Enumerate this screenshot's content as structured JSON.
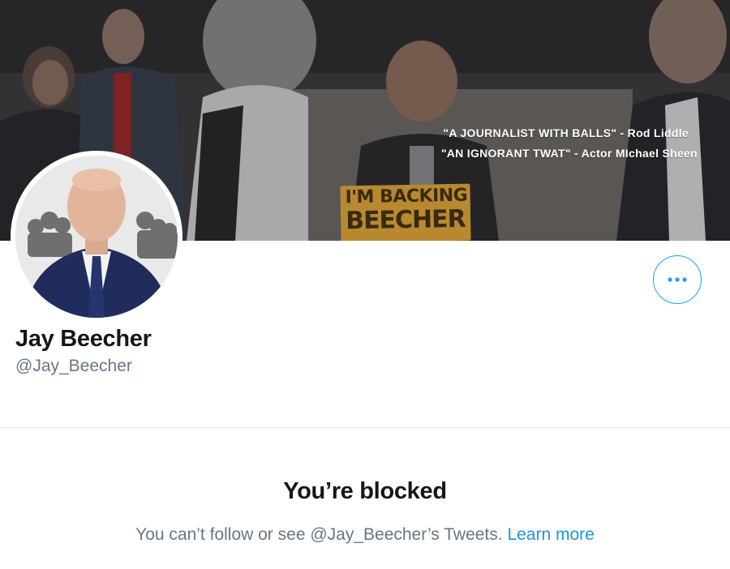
{
  "profile": {
    "display_name": "Jay Beecher",
    "handle": "@Jay_Beecher"
  },
  "banner": {
    "quote_1": "\"A JOURNALIST WITH BALLS\" - Rod Liddle",
    "quote_2": "\"AN IGNORANT TWAT\" - Actor MIchael Sheen",
    "sign_line_1": "I'M BACKING",
    "sign_line_2": "BEECHER"
  },
  "actions": {
    "more_icon": "more-horizontal-icon"
  },
  "blocked": {
    "title": "You’re blocked",
    "message": "You can’t follow or see @Jay_Beecher’s Tweets.",
    "link": "Learn more"
  },
  "colors": {
    "accent": "#1da1f2",
    "link": "#1b95e0",
    "text_primary": "#14171a",
    "text_secondary": "#657786",
    "divider": "#e6ecf0"
  }
}
